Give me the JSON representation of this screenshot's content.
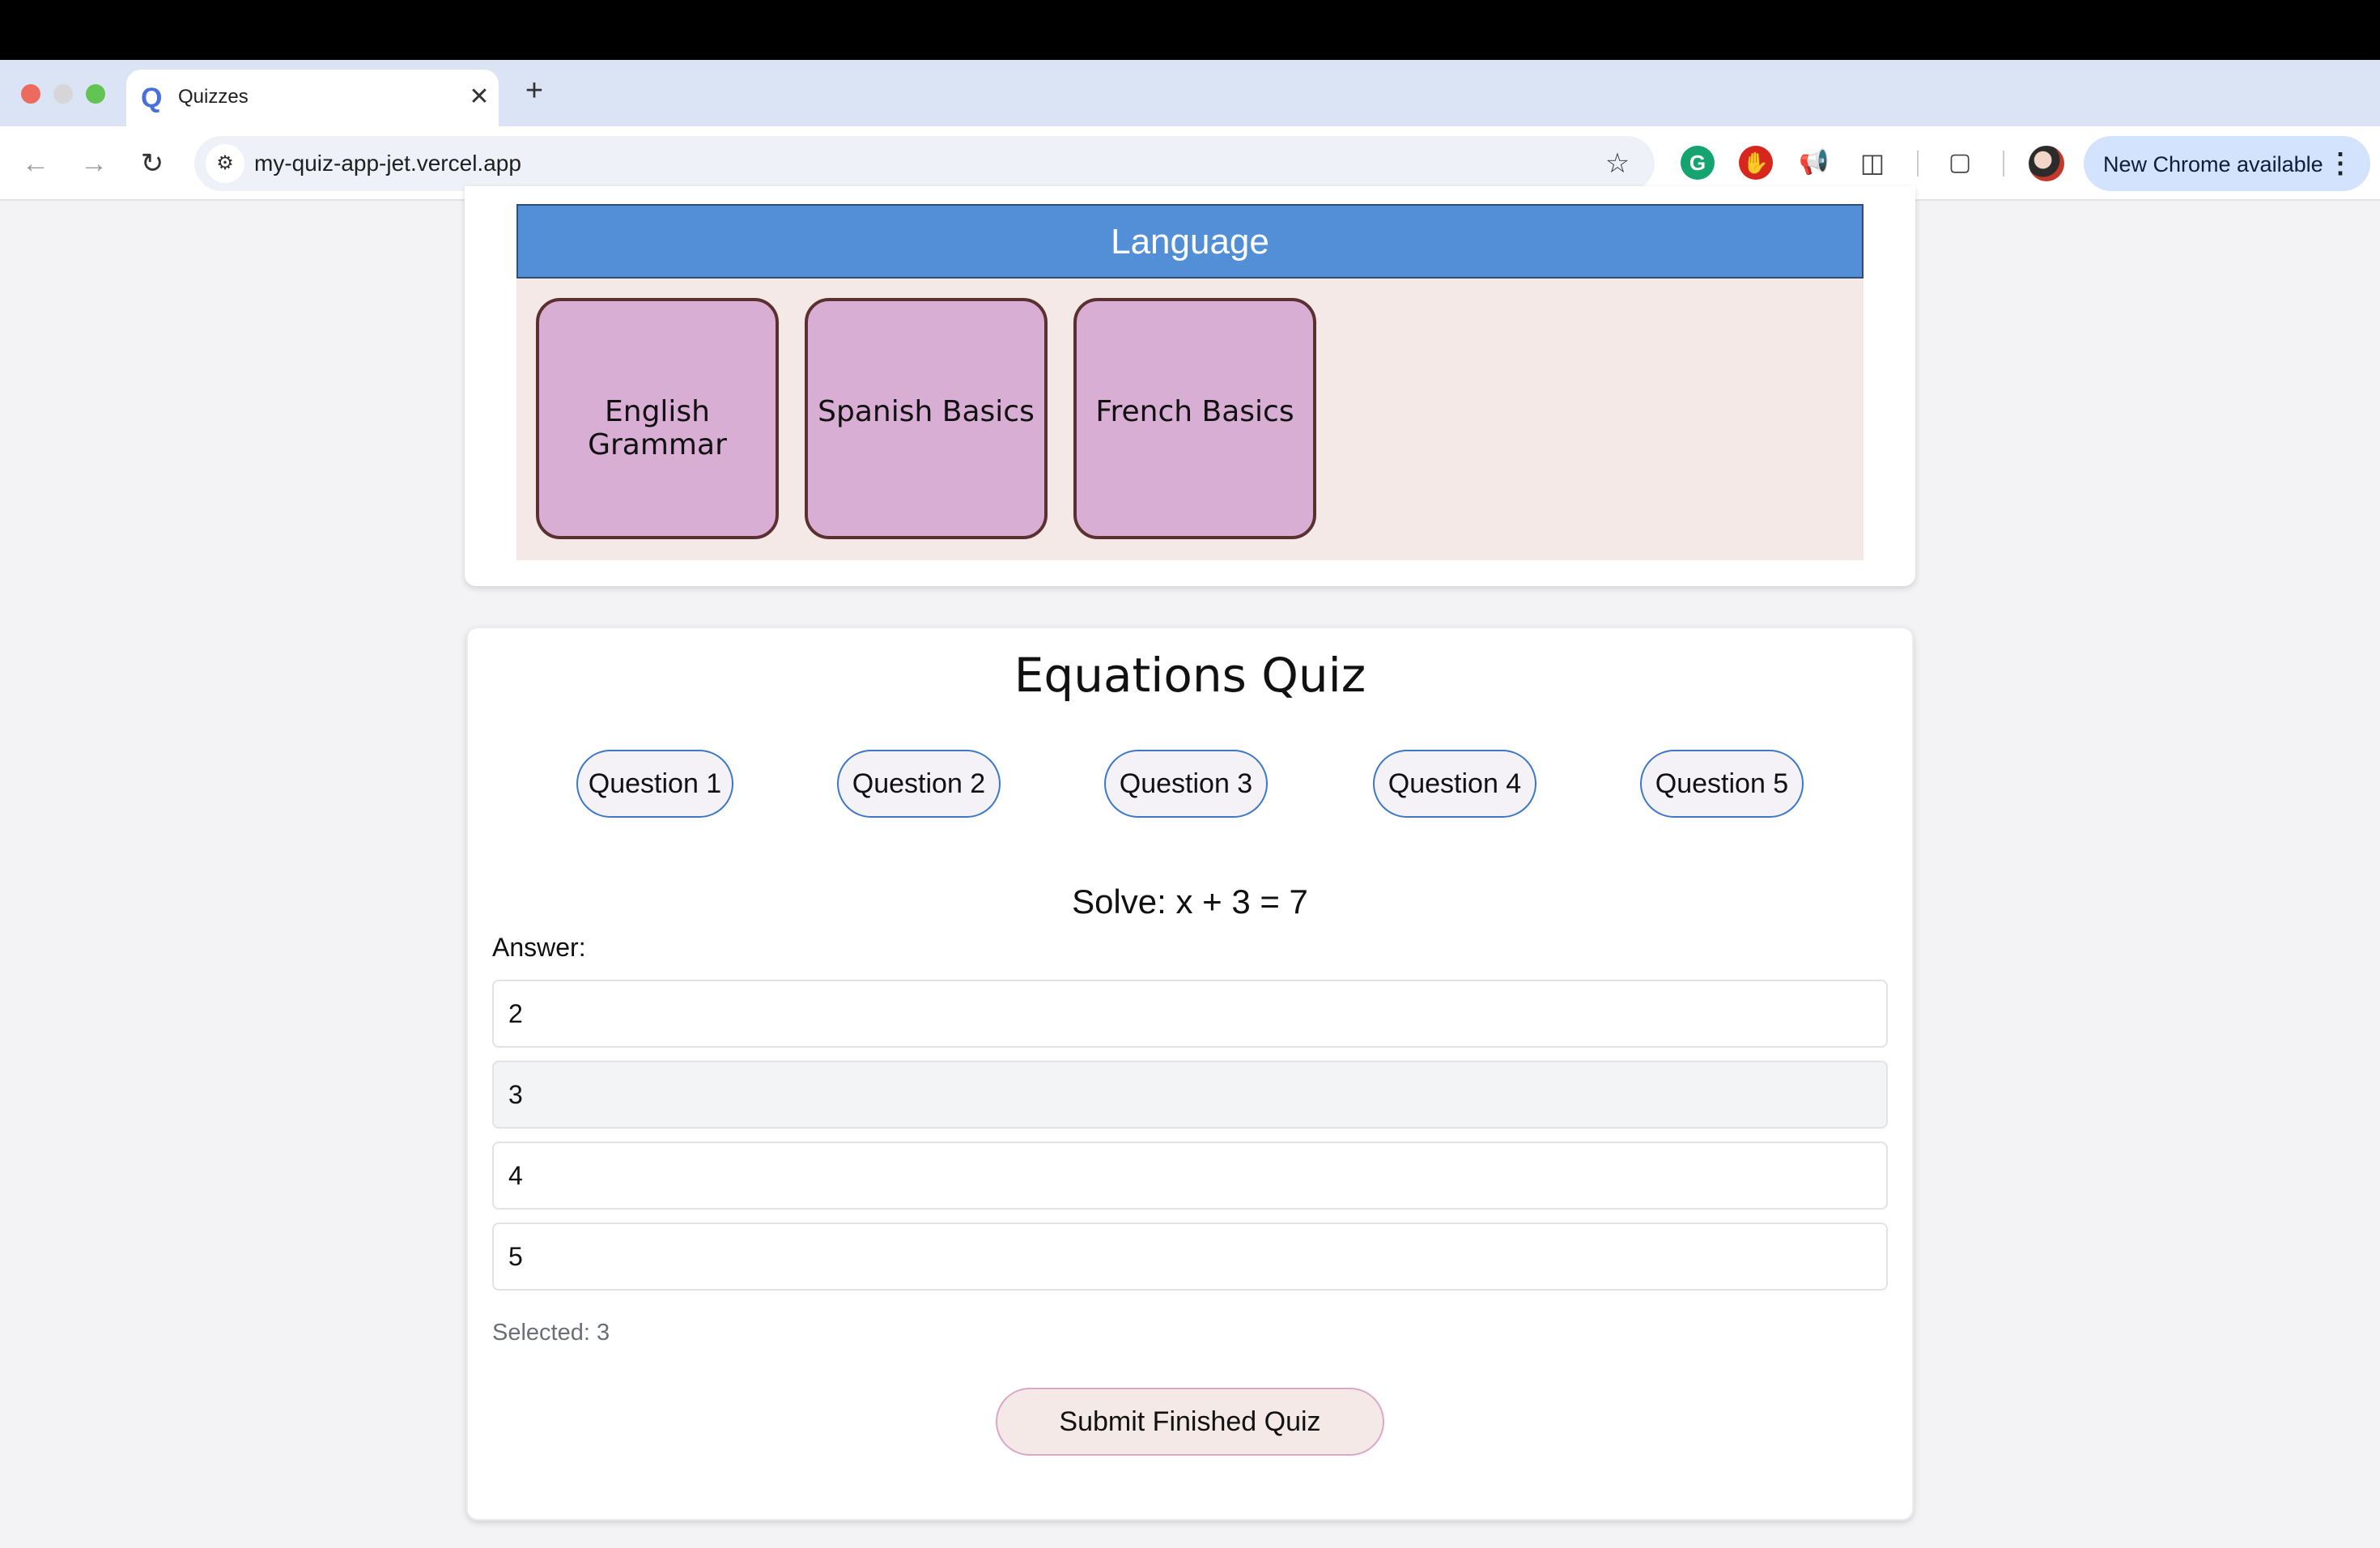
{
  "browser": {
    "tab_title": "Quizzes",
    "tab_favicon": "Q",
    "close_glyph": "✕",
    "new_tab_glyph": "+",
    "url": "my-quiz-app-jet.vercel.app",
    "update_label": "New Chrome available"
  },
  "category": {
    "title": "Language",
    "quizzes": [
      "English Grammar",
      "Spanish Basics",
      "French Basics"
    ]
  },
  "quiz": {
    "title": "Equations Quiz",
    "question_tabs": [
      "Question 1",
      "Question 2",
      "Question 3",
      "Question 4",
      "Question 5"
    ],
    "question": "Solve: x + 3 = 7",
    "answer_label": "Answer:",
    "options": [
      "2",
      "3",
      "4",
      "5"
    ],
    "selected_index": 1,
    "selected_text": "Selected: 3",
    "submit_label": "Submit Finished Quiz"
  },
  "colors": {
    "category_header": "#528fd6",
    "tile_fill": "#d9aed4",
    "question_button_border": "#3d78c7",
    "submit_border": "#d9a8c8"
  },
  "icons": {
    "back": "back-arrow-icon",
    "forward": "forward-arrow-icon",
    "reload": "reload-icon",
    "site_info": "site-info-icon",
    "bookmark": "star-icon",
    "extensions": [
      "grammarly-icon",
      "adblock-icon",
      "megaphone-icon",
      "puzzle-extensions-icon",
      "media-search-icon"
    ],
    "menu": "kebab-menu-icon"
  }
}
